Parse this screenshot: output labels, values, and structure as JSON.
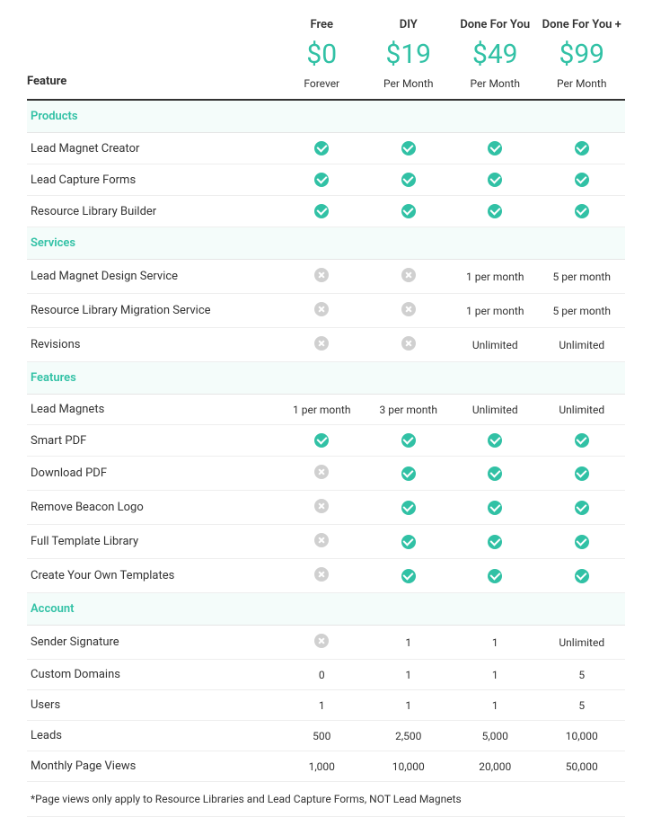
{
  "heading": "Feature",
  "plans": [
    {
      "name": "Free",
      "price": "$0",
      "period": "Forever"
    },
    {
      "name": "DIY",
      "price": "$19",
      "period": "Per Month"
    },
    {
      "name": "Done For You",
      "price": "$49",
      "period": "Per Month"
    },
    {
      "name": "Done For You +",
      "price": "$99",
      "period": "Per Month"
    }
  ],
  "sections": [
    {
      "title": "Products",
      "rows": [
        {
          "label": "Lead Magnet Creator",
          "values": [
            "check",
            "check",
            "check",
            "check"
          ]
        },
        {
          "label": "Lead Capture Forms",
          "values": [
            "check",
            "check",
            "check",
            "check"
          ]
        },
        {
          "label": "Resource Library Builder",
          "values": [
            "check",
            "check",
            "check",
            "check"
          ]
        }
      ]
    },
    {
      "title": "Services",
      "rows": [
        {
          "label": "Lead Magnet Design Service",
          "values": [
            "cross",
            "cross",
            "1 per month",
            "5 per month"
          ]
        },
        {
          "label": "Resource Library Migration Service",
          "values": [
            "cross",
            "cross",
            "1 per month",
            "5 per month"
          ]
        },
        {
          "label": "Revisions",
          "values": [
            "cross",
            "cross",
            "Unlimited",
            "Unlimited"
          ]
        }
      ]
    },
    {
      "title": "Features",
      "rows": [
        {
          "label": "Lead Magnets",
          "values": [
            "1 per month",
            "3 per month",
            "Unlimited",
            "Unlimited"
          ]
        },
        {
          "label": "Smart PDF",
          "values": [
            "check",
            "check",
            "check",
            "check"
          ]
        },
        {
          "label": "Download PDF",
          "values": [
            "cross",
            "check",
            "check",
            "check"
          ]
        },
        {
          "label": "Remove Beacon Logo",
          "values": [
            "cross",
            "check",
            "check",
            "check"
          ]
        },
        {
          "label": "Full Template Library",
          "values": [
            "cross",
            "check",
            "check",
            "check"
          ]
        },
        {
          "label": "Create Your Own Templates",
          "values": [
            "cross",
            "check",
            "check",
            "check"
          ]
        }
      ]
    },
    {
      "title": "Account",
      "rows": [
        {
          "label": "Sender Signature",
          "values": [
            "cross",
            "1",
            "1",
            "Unlimited"
          ]
        },
        {
          "label": "Custom Domains",
          "values": [
            "0",
            "1",
            "1",
            "5"
          ]
        },
        {
          "label": "Users",
          "values": [
            "1",
            "1",
            "1",
            "5"
          ]
        },
        {
          "label": "Leads",
          "values": [
            "500",
            "2,500",
            "5,000",
            "10,000"
          ]
        },
        {
          "label": "Monthly Page Views",
          "values": [
            "1,000",
            "10,000",
            "20,000",
            "50,000"
          ]
        }
      ]
    }
  ],
  "footnote": "*Page views only apply to Resource Libraries and Lead Capture Forms, NOT Lead Magnets"
}
